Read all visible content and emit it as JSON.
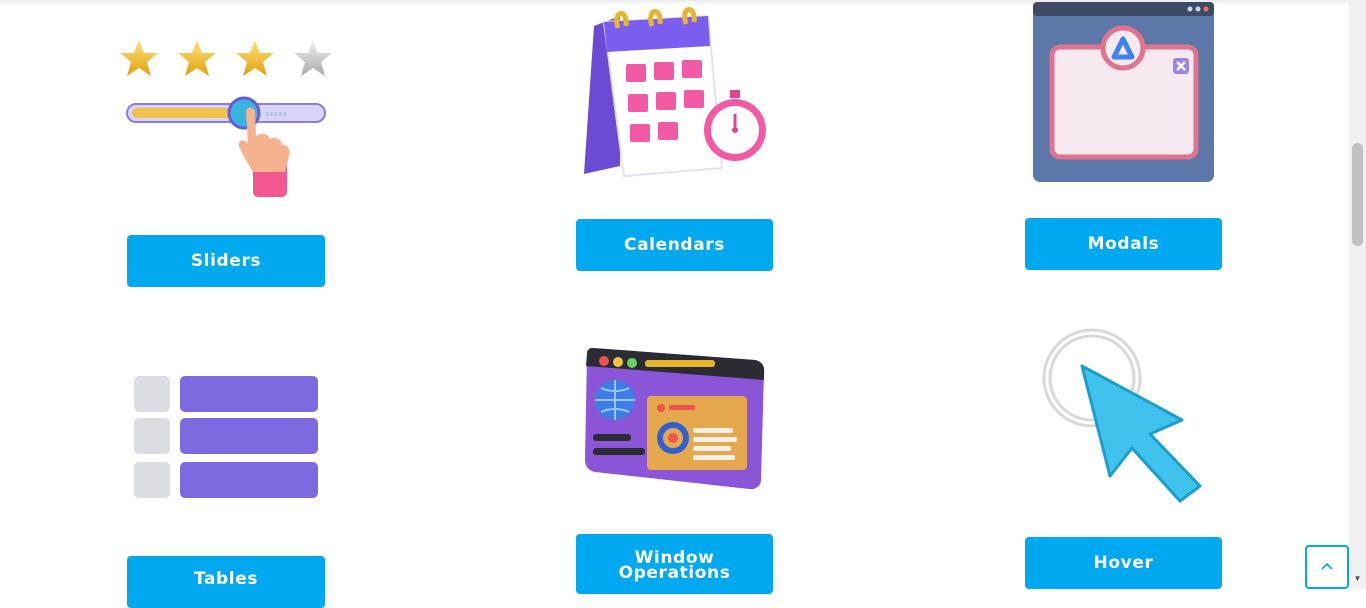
{
  "cards": {
    "sliders": {
      "label": "Sliders"
    },
    "calendars": {
      "label": "Calendars"
    },
    "modals": {
      "label": "Modals"
    },
    "tables": {
      "label": "Tables"
    },
    "window_operations": {
      "label_line1": "Window",
      "label_line2": "Operations"
    },
    "hover": {
      "label": "Hover"
    }
  },
  "slider_illustration": {
    "rating": 3,
    "rating_max": 4
  },
  "colors": {
    "accent": "#00a8f0",
    "purple": "#7b63e0",
    "pink": "#f25aa6"
  },
  "icons": {
    "scroll_to_top": "chevron-up-icon",
    "scroll_down": "triangle-down-icon"
  }
}
